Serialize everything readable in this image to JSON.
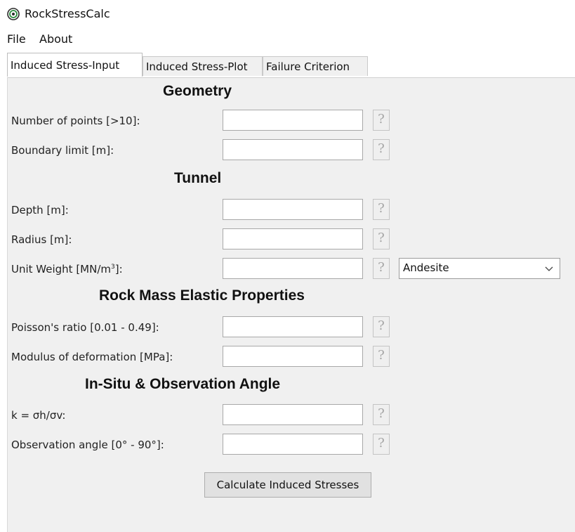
{
  "window": {
    "title": "RockStressCalc",
    "icon": "target-icon"
  },
  "menu": {
    "file": "File",
    "about": "About"
  },
  "tabs": [
    {
      "label": "Induced Stress-Input",
      "active": true
    },
    {
      "label": "Induced Stress-Plot",
      "active": false
    },
    {
      "label": "Failure Criterion",
      "active": false
    }
  ],
  "sections": {
    "geometry": "Geometry",
    "tunnel": "Tunnel",
    "rock_mass": "Rock Mass Elastic Properties",
    "in_situ": "In-Situ & Observation Angle"
  },
  "fields": {
    "num_points": {
      "label": "Number of points [>10]:",
      "value": ""
    },
    "boundary_limit": {
      "label": "Boundary limit [m]:",
      "value": ""
    },
    "depth": {
      "label": "Depth [m]:",
      "value": ""
    },
    "radius": {
      "label": "Radius [m]:",
      "value": ""
    },
    "unit_weight": {
      "label_prefix": "Unit Weight [MN/m",
      "label_sup": "3",
      "label_suffix": "]:",
      "value": ""
    },
    "poisson": {
      "label": "Poisson's ratio [0.01 - 0.49]:",
      "value": ""
    },
    "modulus": {
      "label": "Modulus of deformation [MPa]:",
      "value": ""
    },
    "k_ratio": {
      "label": "k = σh/σv:",
      "value": ""
    },
    "obs_angle": {
      "label": "Observation angle [0° - 90°]:",
      "value": ""
    }
  },
  "help_button": "?",
  "rock_type_select": {
    "selected": "Andesite"
  },
  "calculate_button": "Calculate Induced Stresses"
}
